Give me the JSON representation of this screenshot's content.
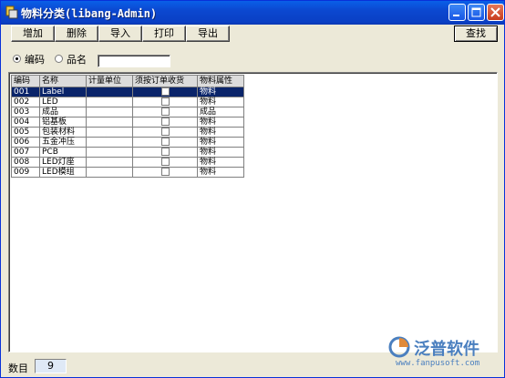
{
  "window": {
    "title": "物料分类(libang-Admin)"
  },
  "toolbar": {
    "buttons": [
      "增加",
      "删除",
      "导入",
      "打印",
      "导出"
    ],
    "search_label": "查找"
  },
  "filter": {
    "options": [
      "编码",
      "品名"
    ],
    "selected": "编码",
    "value": ""
  },
  "grid": {
    "columns": [
      "编码",
      "名称",
      "计量单位",
      "须按订单收货",
      "物料属性"
    ],
    "rows": [
      {
        "code": "001",
        "name": "Label",
        "unit": "",
        "order_receipt": false,
        "attribute": "物料",
        "selected": true
      },
      {
        "code": "002",
        "name": "LED",
        "unit": "",
        "order_receipt": false,
        "attribute": "物料"
      },
      {
        "code": "003",
        "name": "成品",
        "unit": "",
        "order_receipt": false,
        "attribute": "成品"
      },
      {
        "code": "004",
        "name": "铝基板",
        "unit": "",
        "order_receipt": false,
        "attribute": "物料"
      },
      {
        "code": "005",
        "name": "包装材料",
        "unit": "",
        "order_receipt": false,
        "attribute": "物料"
      },
      {
        "code": "006",
        "name": "五金冲压",
        "unit": "",
        "order_receipt": false,
        "attribute": "物料"
      },
      {
        "code": "007",
        "name": "PCB",
        "unit": "",
        "order_receipt": false,
        "attribute": "物料"
      },
      {
        "code": "008",
        "name": "LED灯座",
        "unit": "",
        "order_receipt": false,
        "attribute": "物料"
      },
      {
        "code": "009",
        "name": "LED模组",
        "unit": "",
        "order_receipt": false,
        "attribute": "物料"
      }
    ]
  },
  "footer": {
    "count_label": "数目",
    "count_value": "9"
  },
  "watermark": {
    "brand": "泛普软件",
    "url": "www.fanpusoft.com"
  },
  "colors": {
    "titlebar": "#0a4fd6",
    "selection": "#0a246a",
    "watermark": "#4a7fbf"
  }
}
